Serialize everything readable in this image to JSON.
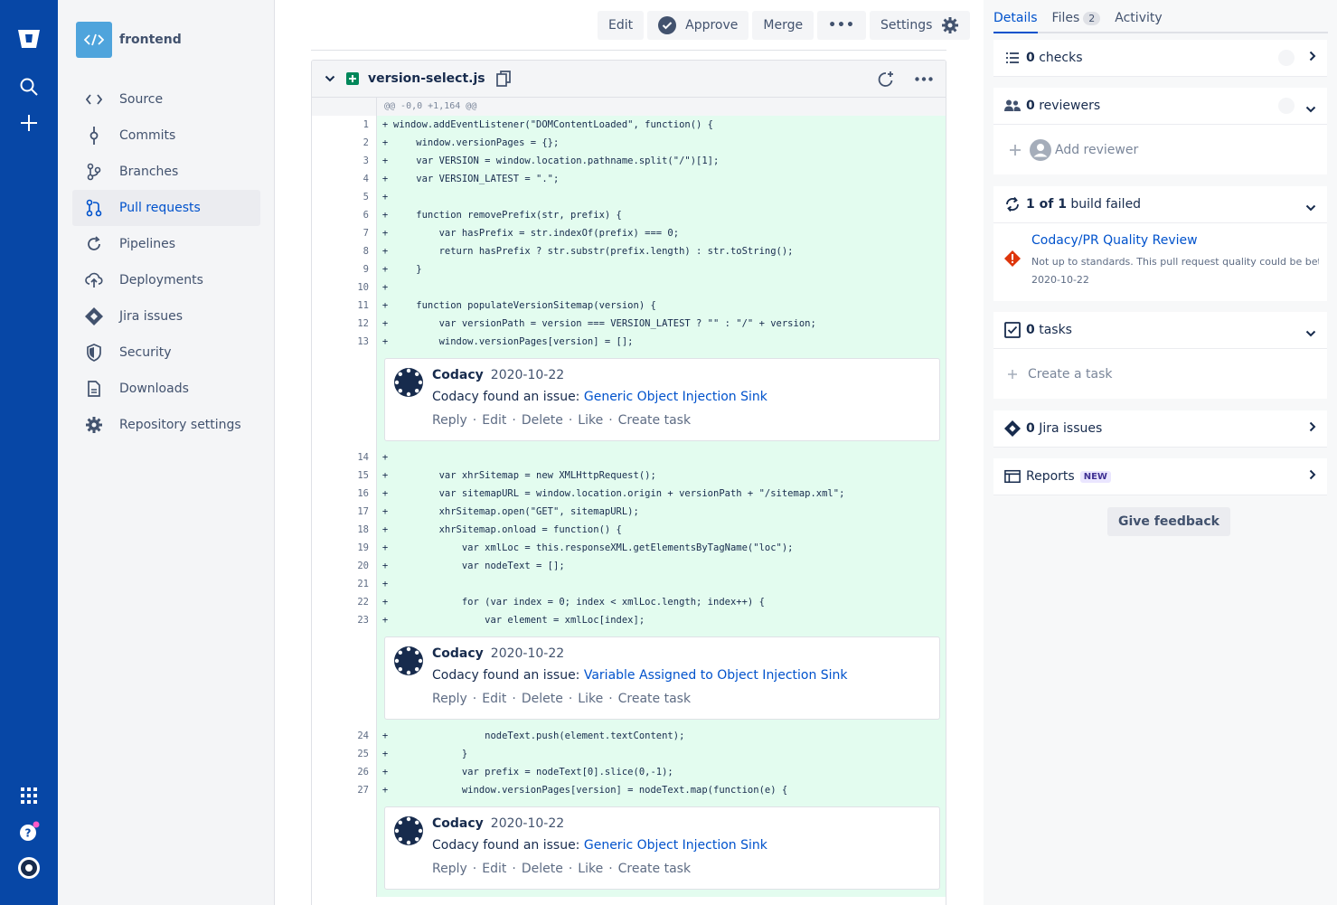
{
  "rail": {
    "icons": [
      "bitbucket-logo-icon",
      "search-icon",
      "create-icon",
      "apps-icon",
      "help-icon",
      "profile-avatar-icon"
    ]
  },
  "sidebar": {
    "repo_name": "frontend",
    "items": [
      {
        "label": "Source",
        "icon": "source-code-icon"
      },
      {
        "label": "Commits",
        "icon": "commit-icon"
      },
      {
        "label": "Branches",
        "icon": "branch-icon"
      },
      {
        "label": "Pull requests",
        "icon": "pull-request-icon",
        "active": true
      },
      {
        "label": "Pipelines",
        "icon": "pipeline-icon"
      },
      {
        "label": "Deployments",
        "icon": "deployments-icon"
      },
      {
        "label": "Jira issues",
        "icon": "jira-icon"
      },
      {
        "label": "Security",
        "icon": "shield-icon"
      },
      {
        "label": "Downloads",
        "icon": "document-icon"
      },
      {
        "label": "Repository settings",
        "icon": "gear-icon"
      }
    ]
  },
  "toolbar": {
    "edit": "Edit",
    "approve": "Approve",
    "merge": "Merge",
    "more": "•••",
    "settings": "Settings"
  },
  "file": {
    "name": "version-select.js",
    "hunk_header": "@@ -0,0 +1,164 @@",
    "lines": [
      {
        "n": "1",
        "code": "window.addEventListener(\"DOMContentLoaded\", function() {"
      },
      {
        "n": "2",
        "code": "    window.versionPages = {};"
      },
      {
        "n": "3",
        "code": "    var VERSION = window.location.pathname.split(\"/\")[1];"
      },
      {
        "n": "4",
        "code": "    var VERSION_LATEST = \".\";"
      },
      {
        "n": "5",
        "code": ""
      },
      {
        "n": "6",
        "code": "    function removePrefix(str, prefix) {"
      },
      {
        "n": "7",
        "code": "        var hasPrefix = str.indexOf(prefix) === 0;"
      },
      {
        "n": "8",
        "code": "        return hasPrefix ? str.substr(prefix.length) : str.toString();"
      },
      {
        "n": "9",
        "code": "    }"
      },
      {
        "n": "10",
        "code": ""
      },
      {
        "n": "11",
        "code": "    function populateVersionSitemap(version) {"
      },
      {
        "n": "12",
        "code": "        var versionPath = version === VERSION_LATEST ? \"\" : \"/\" + version;"
      },
      {
        "n": "13",
        "code": "        window.versionPages[version] = [];"
      },
      {
        "n": "14",
        "code": ""
      },
      {
        "n": "15",
        "code": "        var xhrSitemap = new XMLHttpRequest();"
      },
      {
        "n": "16",
        "code": "        var sitemapURL = window.location.origin + versionPath + \"/sitemap.xml\";"
      },
      {
        "n": "17",
        "code": "        xhrSitemap.open(\"GET\", sitemapURL);"
      },
      {
        "n": "18",
        "code": "        xhrSitemap.onload = function() {"
      },
      {
        "n": "19",
        "code": "            var xmlLoc = this.responseXML.getElementsByTagName(\"loc\");"
      },
      {
        "n": "20",
        "code": "            var nodeText = [];"
      },
      {
        "n": "21",
        "code": ""
      },
      {
        "n": "22",
        "code": "            for (var index = 0; index < xmlLoc.length; index++) {"
      },
      {
        "n": "23",
        "code": "                var element = xmlLoc[index];"
      },
      {
        "n": "24",
        "code": "                nodeText.push(element.textContent);"
      },
      {
        "n": "25",
        "code": "            }"
      },
      {
        "n": "26",
        "code": "            var prefix = nodeText[0].slice(0,-1);"
      },
      {
        "n": "27",
        "code": "            window.versionPages[version] = nodeText.map(function(e) {"
      }
    ],
    "comments": [
      {
        "after_line": "13",
        "author": "Codacy",
        "date": "2020-10-22",
        "text": "Codacy found an issue: ",
        "link": "Generic Object Injection Sink"
      },
      {
        "after_line": "23",
        "author": "Codacy",
        "date": "2020-10-22",
        "text": "Codacy found an issue: ",
        "link": "Variable Assigned to Object Injection Sink"
      },
      {
        "after_line": "27",
        "author": "Codacy",
        "date": "2020-10-22",
        "text": "Codacy found an issue: ",
        "link": "Generic Object Injection Sink"
      }
    ],
    "comment_actions": [
      "Reply",
      "Edit",
      "Delete",
      "Like",
      "Create task"
    ]
  },
  "right": {
    "tabs": [
      {
        "label": "Details",
        "active": true
      },
      {
        "label": "Files",
        "badge": "2"
      },
      {
        "label": "Activity"
      }
    ],
    "checks": {
      "count": "0",
      "label": " checks"
    },
    "reviewers": {
      "count": "0",
      "label": " reviewers",
      "add": "Add reviewer"
    },
    "builds": {
      "count": "1 of 1",
      "label": " build failed",
      "name": "Codacy/PR Quality Review",
      "desc": "Not up to standards. This pull request quality could be better...",
      "date": "2020-10-22"
    },
    "tasks": {
      "count": "0",
      "label": " tasks",
      "create": "Create a task"
    },
    "jira": {
      "count": "0",
      "label": " Jira issues"
    },
    "reports": {
      "label": "Reports",
      "badge": "NEW"
    },
    "feedback": "Give feedback"
  },
  "colors": {
    "rail": "#0747a6",
    "link": "#0052cc",
    "added": "#e3fcef",
    "error": "#de350b"
  }
}
